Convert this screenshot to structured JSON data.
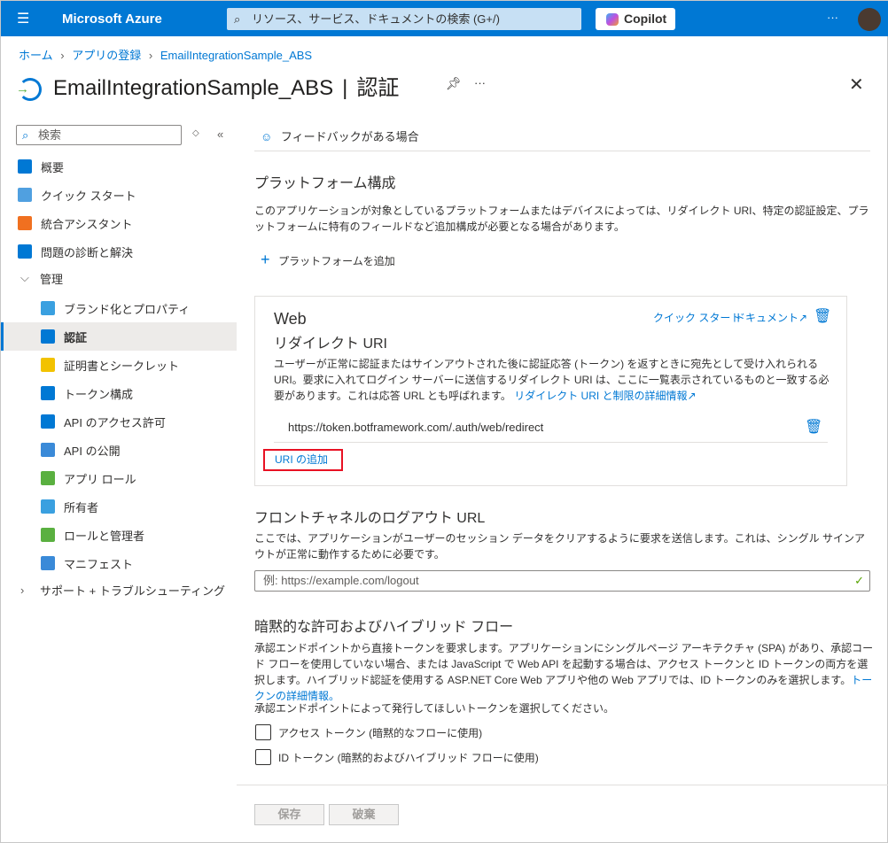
{
  "topbar": {
    "brand": "Microsoft Azure",
    "search_placeholder": "リソース、サービス、ドキュメントの検索 (G+/)",
    "copilot": "Copilot",
    "more": "···"
  },
  "breadcrumb": [
    "ホーム",
    "アプリの登録",
    "EmailIntegrationSample_ABS"
  ],
  "header": {
    "title": "EmailIntegrationSample_ABS",
    "section": "認証",
    "more": "···"
  },
  "sidebar": {
    "search_placeholder": "検索",
    "items": [
      {
        "label": "概要",
        "color": "#0078d4"
      },
      {
        "label": "クイック スタート",
        "color": "#50a0e0"
      },
      {
        "label": "統合アシスタント",
        "color": "#f07020"
      },
      {
        "label": "問題の診断と解決",
        "color": "#0078d4"
      },
      {
        "label": "管理"
      },
      {
        "label": "ブランド化とプロパティ",
        "color": "#3aa0e0"
      },
      {
        "label": "認証",
        "color": "#0078d4"
      },
      {
        "label": "証明書とシークレット",
        "color": "#f2c200"
      },
      {
        "label": "トークン構成",
        "color": "#0078d4"
      },
      {
        "label": "API のアクセス許可",
        "color": "#0078d4"
      },
      {
        "label": "API の公開",
        "color": "#3a8ad8"
      },
      {
        "label": "アプリ ロール",
        "color": "#5ab040"
      },
      {
        "label": "所有者",
        "color": "#3aa0e0"
      },
      {
        "label": "ロールと管理者",
        "color": "#5ab040"
      },
      {
        "label": "マニフェスト",
        "color": "#3a8ad8"
      },
      {
        "label": "サポート + トラブルシューティング"
      }
    ]
  },
  "main": {
    "feedback": "フィードバックがある場合",
    "platform_heading": "プラットフォーム構成",
    "platform_desc": "このアプリケーションが対象としているプラットフォームまたはデバイスによっては、リダイレクト URI、特定の認証設定、プラットフォームに特有のフィールドなど追加構成が必要となる場合があります。",
    "add_platform": "プラットフォームを追加",
    "web": {
      "title": "Web",
      "quickstart": "クイック スタート",
      "docs": "ドキュメント",
      "subtitle": "リダイレクト URI",
      "desc": "ユーザーが正常に認証またはサインアウトされた後に認証応答 (トークン) を返すときに宛先として受け入れられる URI。要求に入れてログイン サーバーに送信するリダイレクト URI は、ここに一覧表示されているものと一致する必要があります。これは応答 URL とも呼ばれます。",
      "desc_link": "リダイレクト URI と制限の詳細情報",
      "uri": "https://token.botframework.com/.auth/web/redirect",
      "add_uri": "URI の追加"
    },
    "frontchannel": {
      "heading": "フロントチャネルのログアウト URL",
      "desc": "ここでは、アプリケーションがユーザーのセッション データをクリアするように要求を送信します。これは、シングル サインアウトが正常に動作するために必要です。",
      "placeholder": "例: https://example.com/logout"
    },
    "implicit": {
      "heading": "暗黙的な許可およびハイブリッド フロー",
      "desc": "承認エンドポイントから直接トークンを要求します。アプリケーションにシングルページ アーキテクチャ (SPA) があり、承認コード フローを使用していない場合、または JavaScript で Web API を起動する場合は、アクセス トークンと ID トークンの両方を選択します。ハイブリッド認証を使用する ASP.NET Core Web アプリや他の Web アプリでは、ID トークンのみを選択します。",
      "desc_link": "トークンの詳細情報。",
      "prompt": "承認エンドポイントによって発行してほしいトークンを選択してください。",
      "access_token": "アクセス トークン (暗黙的なフローに使用)",
      "access_token_checked": false,
      "id_token": "ID トークン (暗黙的およびハイブリッド フローに使用)",
      "id_token_checked": false
    },
    "save": "保存",
    "discard": "破棄"
  }
}
